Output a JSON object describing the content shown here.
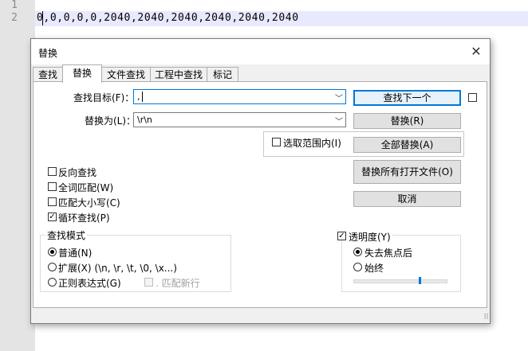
{
  "editor": {
    "line_numbers": [
      "1",
      "2"
    ],
    "line2_text": "0,0,0,0,0,2040,2040,2040,2040,2040,2040"
  },
  "dialog": {
    "title": "替换",
    "tabs": [
      "查找",
      "替换",
      "文件查找",
      "工程中查找",
      "标记"
    ],
    "find_label": "查找目标(F)：",
    "find_value": ",",
    "replace_label": "替换为(L)：",
    "replace_value": "\\r\\n",
    "in_selection_label": "选取范围内(I)",
    "buttons": {
      "find_next": "查找下一个",
      "replace": "替换(R)",
      "replace_all": "全部替换(A)",
      "replace_all_open": "替换所有打开文件(O)",
      "cancel": "取消"
    },
    "options": {
      "backward": "反向查找",
      "whole_word": "全词匹配(W)",
      "match_case": "匹配大小写(C)",
      "wrap_around": "循环查找(P)"
    },
    "search_mode": {
      "title": "查找模式",
      "normal": "普通(N)",
      "extended": "扩展(X) (\\n, \\r, \\t, \\0, \\x...)",
      "regex": "正则表达式(G)",
      "dot_newline": ". 匹配新行"
    },
    "transparency": {
      "title": "透明度(Y)",
      "on_lose_focus": "失去焦点后",
      "always": "始终",
      "level_fraction": 0.7
    }
  }
}
